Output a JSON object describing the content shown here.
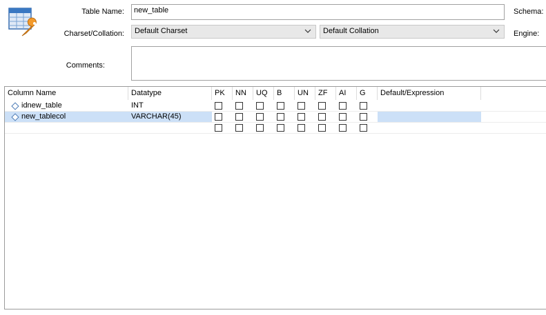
{
  "form": {
    "table_name_label": "Table Name:",
    "table_name_value": "new_table",
    "schema_label": "Schema:",
    "charset_label": "Charset/Collation:",
    "charset_value": "Default Charset",
    "collation_value": "Default Collation",
    "engine_label": "Engine:",
    "comments_label": "Comments:",
    "comments_value": ""
  },
  "grid": {
    "headers": {
      "column_name": "Column Name",
      "datatype": "Datatype",
      "pk": "PK",
      "nn": "NN",
      "uq": "UQ",
      "b": "B",
      "un": "UN",
      "zf": "ZF",
      "ai": "AI",
      "g": "G",
      "default": "Default/Expression"
    },
    "rows": [
      {
        "name": "idnew_table",
        "datatype": "INT",
        "default": ""
      },
      {
        "name": "new_tablecol",
        "datatype": "VARCHAR(45)",
        "default": ""
      },
      {
        "name": "",
        "datatype": "",
        "default": ""
      }
    ]
  },
  "colors": {
    "selection": "#cce0f7",
    "combo_bg": "#e8e8e8"
  }
}
